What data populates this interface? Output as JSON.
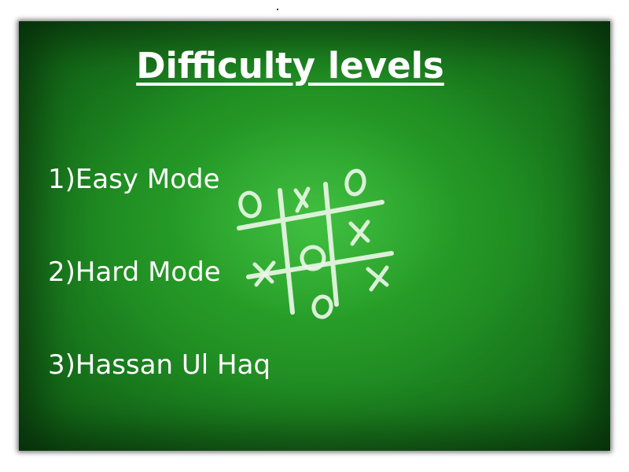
{
  "screen": {
    "title": "Difficulty levels",
    "background_color": "#1f8a22",
    "text_color": "#ffffff"
  },
  "menu": {
    "items": [
      {
        "label": "1)Easy Mode"
      },
      {
        "label": "2)Hard Mode"
      },
      {
        "label": "3)Hassan Ul Haq"
      }
    ]
  },
  "decoration": {
    "icon": "tic-tac-toe-board-icon",
    "board": {
      "cells": [
        [
          "O",
          "X",
          "O"
        ],
        [
          "",
          "",
          "X"
        ],
        [
          "X",
          "O",
          "X"
        ],
        [
          "",
          "O",
          ""
        ]
      ]
    }
  }
}
